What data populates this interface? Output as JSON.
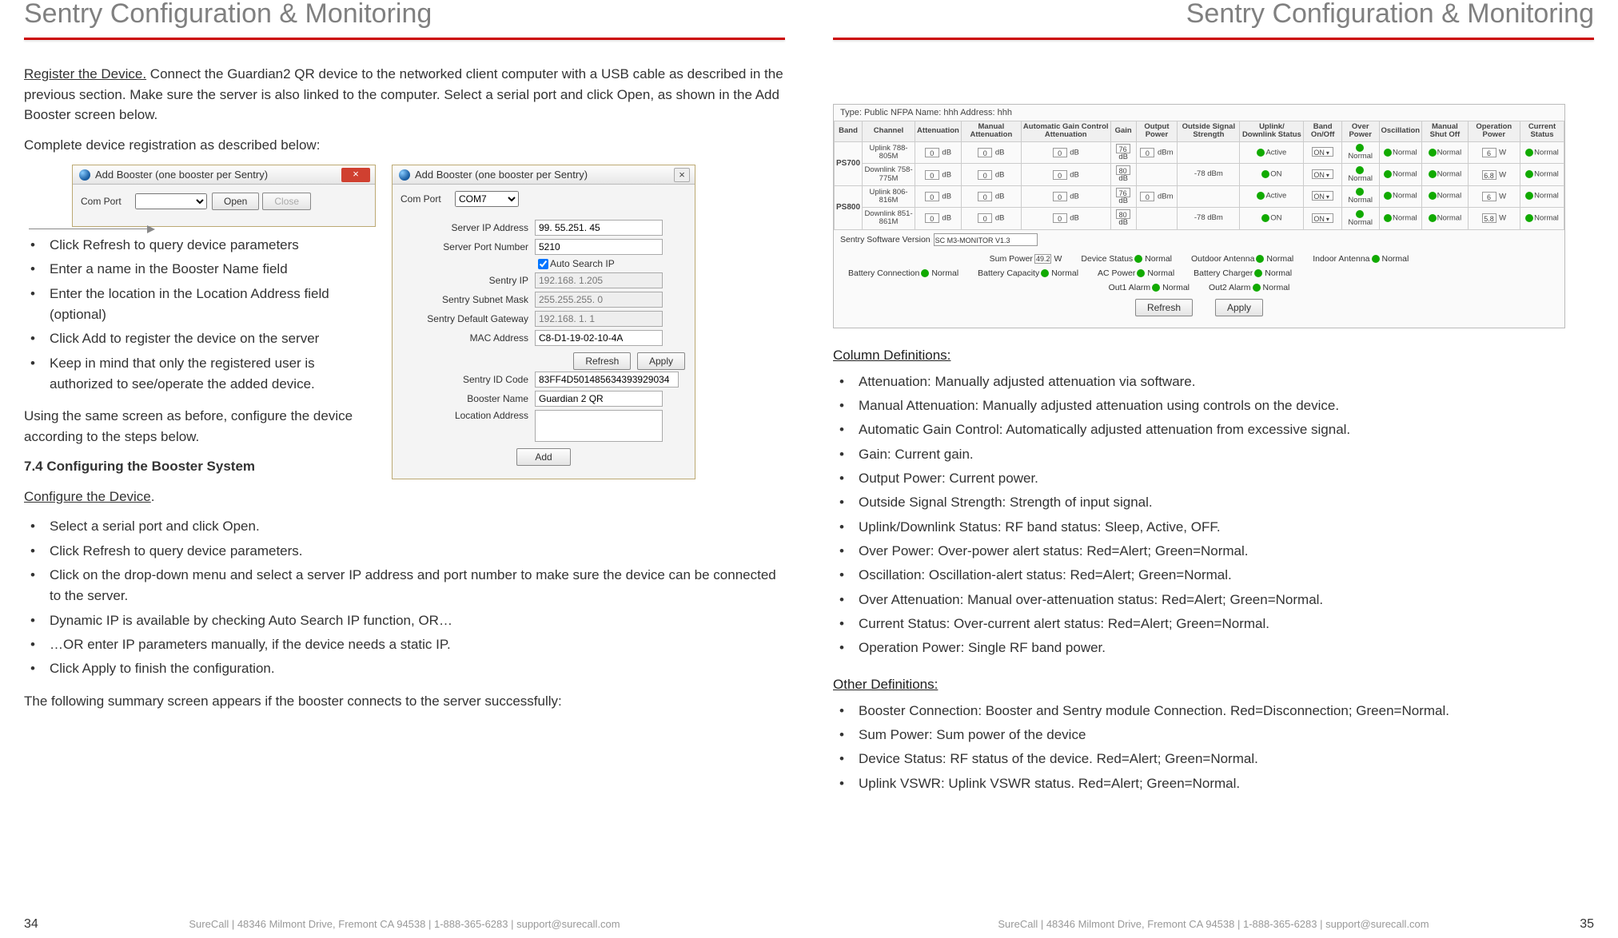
{
  "left": {
    "title": "Sentry Configuration & Monitoring",
    "register_head": "Register the Device.",
    "register_body": " Connect the Guardian2 QR device to the networked client computer with a USB cable as described in the previous section. Make sure the server is also linked to the computer. Select a serial port and click Open, as shown in the Add Booster screen below.",
    "complete_reg": "Complete device registration as described below:",
    "dlg1_title": "Add Booster (one booster per Sentry)",
    "dlg1_comport": "Com Port",
    "dlg1_open": "Open",
    "dlg1_close": "Close",
    "dlg2_title": "Add Booster (one booster per Sentry)",
    "dlg2": {
      "comport": "Com Port",
      "comport_val": "COM7",
      "server_ip_lbl": "Server IP Address",
      "server_ip_val": "99. 55.251. 45",
      "server_port_lbl": "Server Port Number",
      "server_port_val": "5210",
      "autosearch": "Auto Search IP",
      "sentry_ip_lbl": "Sentry IP",
      "sentry_ip_val": "192.168. 1.205",
      "subnet_lbl": "Sentry Subnet Mask",
      "subnet_val": "255.255.255. 0",
      "gateway_lbl": "Sentry Default Gateway",
      "gateway_val": "192.168. 1. 1",
      "mac_lbl": "MAC Address",
      "mac_val": "C8-D1-19-02-10-4A",
      "refresh": "Refresh",
      "apply": "Apply",
      "id_lbl": "Sentry ID Code",
      "id_val": "83FF4D501485634393929034",
      "name_lbl": "Booster Name",
      "name_val": "Guardian 2 QR",
      "addr_lbl": "Location Address",
      "add": "Add"
    },
    "list1": [
      "Click Refresh to query device parameters",
      "Enter a name in the Booster Name field",
      "Enter the location in the Location Address field (optional)",
      "Click Add to register the device on the server",
      "Keep in mind that only the registered user is authorized to see/operate the added device."
    ],
    "using_same": "Using the same screen as before, configure the device according to the steps below.",
    "sec7_4": "7.4 Configuring the Booster System",
    "configure_head": "Configure the Device",
    "list2": [
      "Select a serial port and click Open.",
      "Click Refresh to query device parameters.",
      "Click on the drop-down menu and select a server IP address and port number to make sure the device can be connected to the server.",
      "Dynamic IP is available by checking Auto Search IP function, OR…",
      "…OR enter IP parameters manually, if the device needs a static IP.",
      "Click Apply to finish the configuration."
    ],
    "following": "The following summary screen appears if the booster connects to the server successfully:",
    "footer": "SureCall  |  48346 Milmont Drive, Fremont CA 94538  |  1-888-365-6283  |  support@surecall.com",
    "pagenum": "34"
  },
  "right": {
    "title": "Sentry Configuration & Monitoring",
    "summary": {
      "top": "Type: Public NFPA  Name: hhh  Address: hhh",
      "headers": [
        "Band",
        "Channel",
        "Attenuation",
        "Manual Attenuation",
        "Automatic Gain Control Attenuation",
        "Gain",
        "Output Power",
        "Outside Signal Strength",
        "Uplink/ Downlink Status",
        "Band On/Off",
        "Over Power",
        "Oscillation",
        "Manual Shut Off",
        "Operation Power",
        "Current Status"
      ],
      "rows": [
        {
          "band": "PS700",
          "ch": "Uplink 788-805M",
          "att": "0",
          "attu": "dB",
          "man": "0",
          "manu": "dB",
          "agc": "0",
          "agcu": "dB",
          "gain": "76",
          "gainu": "dB",
          "out": "0",
          "outu": "dBm",
          "oss": "",
          "status": "Active",
          "onoff": "ON",
          "over": "Normal",
          "osc": "Normal",
          "msho": "Normal",
          "op": "6",
          "opu": "W",
          "cs": "Normal"
        },
        {
          "band": "",
          "ch": "Downlink 758-775M",
          "att": "0",
          "attu": "dB",
          "man": "0",
          "manu": "dB",
          "agc": "0",
          "agcu": "dB",
          "gain": "80",
          "gainu": "dB",
          "out": "",
          "outu": "",
          "oss": "-78 dBm",
          "status": "ON",
          "onoff": "ON",
          "over": "Normal",
          "osc": "Normal",
          "msho": "Normal",
          "op": "6.8",
          "opu": "W",
          "cs": "Normal"
        },
        {
          "band": "PS800",
          "ch": "Uplink 806-816M",
          "att": "0",
          "attu": "dB",
          "man": "0",
          "manu": "dB",
          "agc": "0",
          "agcu": "dB",
          "gain": "76",
          "gainu": "dB",
          "out": "0",
          "outu": "dBm",
          "oss": "",
          "status": "Active",
          "onoff": "ON",
          "over": "Normal",
          "osc": "Normal",
          "msho": "Normal",
          "op": "6",
          "opu": "W",
          "cs": "Normal"
        },
        {
          "band": "",
          "ch": "Downlink 851-861M",
          "att": "0",
          "attu": "dB",
          "man": "0",
          "manu": "dB",
          "agc": "0",
          "agcu": "dB",
          "gain": "80",
          "gainu": "dB",
          "out": "",
          "outu": "",
          "oss": "-78 dBm",
          "status": "ON",
          "onoff": "ON",
          "over": "Normal",
          "osc": "Normal",
          "msho": "Normal",
          "op": "5.8",
          "opu": "W",
          "cs": "Normal"
        }
      ],
      "version_lbl": "Sentry Software Version",
      "version_val": "SC M3-MONITOR V1.3",
      "sum_power_lbl": "Sum Power",
      "sum_power_val": "49.2",
      "sum_power_u": "W",
      "device_status_lbl": "Device Status",
      "normal": "Normal",
      "outdoor_lbl": "Outdoor Antenna",
      "indoor_lbl": "Indoor Antenna",
      "batt_conn_lbl": "Battery Connection",
      "batt_cap_lbl": "Battery Capacity",
      "ac_lbl": "AC Power",
      "charger_lbl": "Battery Charger",
      "out1_lbl": "Out1 Alarm",
      "out2_lbl": "Out2 Alarm",
      "refresh": "Refresh",
      "apply": "Apply"
    },
    "coldef_head": "Column Definitions:",
    "coldef": [
      "Attenuation: Manually adjusted attenuation via software.",
      "Manual Attenuation: Manually adjusted attenuation using controls on the device.",
      "Automatic Gain Control: Automatically adjusted attenuation from excessive signal.",
      "Gain: Current gain.",
      "Output Power: Current power.",
      "Outside Signal Strength: Strength of input signal.",
      "Uplink/Downlink Status: RF band status: Sleep, Active, OFF.",
      "Over Power: Over-power alert status: Red=Alert; Green=Normal.",
      "Oscillation: Oscillation-alert status: Red=Alert; Green=Normal.",
      "Over Attenuation: Manual over-attenuation status: Red=Alert; Green=Normal.",
      "Current Status: Over-current alert status: Red=Alert; Green=Normal.",
      "Operation Power: Single RF band power."
    ],
    "otherdef_head": "Other Definitions:",
    "otherdef": [
      "Booster Connection: Booster and Sentry module Connection. Red=Disconnection; Green=Normal.",
      "Sum Power: Sum power of the device",
      "Device Status: RF status of the device. Red=Alert; Green=Normal.",
      "Uplink VSWR: Uplink VSWR status. Red=Alert; Green=Normal."
    ],
    "footer": "SureCall  |  48346 Milmont Drive, Fremont CA 94538  |  1-888-365-6283  |  support@surecall.com",
    "pagenum": "35"
  }
}
